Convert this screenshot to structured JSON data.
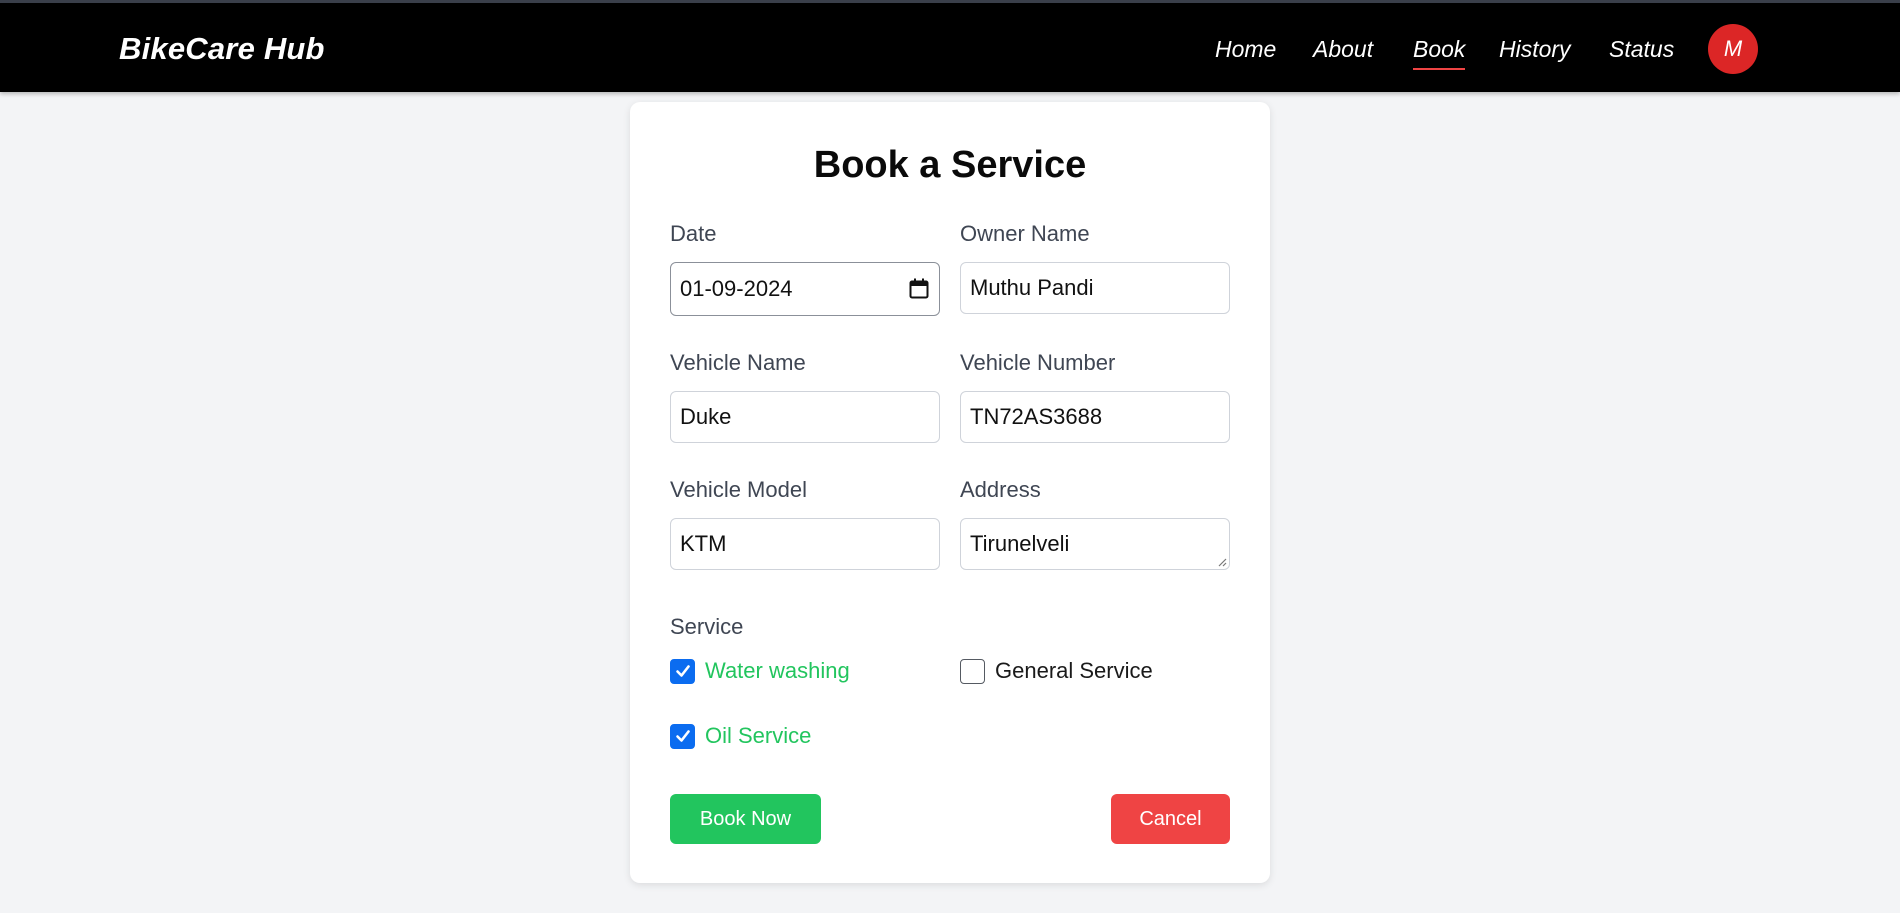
{
  "header": {
    "brand": "BikeCare Hub",
    "nav": [
      {
        "label": "Home",
        "active": false
      },
      {
        "label": "About",
        "active": false
      },
      {
        "label": "Book",
        "active": true
      },
      {
        "label": "History",
        "active": false
      },
      {
        "label": "Status",
        "active": false
      }
    ],
    "avatar_initial": "M",
    "colors": {
      "background": "#000000",
      "active_underline": "#ef4444",
      "avatar": "#dc2626"
    }
  },
  "form": {
    "title": "Book a Service",
    "fields": {
      "date": {
        "label": "Date",
        "value": "01-09-2024",
        "icon": "calendar-icon"
      },
      "owner_name": {
        "label": "Owner Name",
        "value": "Muthu Pandi"
      },
      "vehicle_name": {
        "label": "Vehicle Name",
        "value": "Duke"
      },
      "vehicle_number": {
        "label": "Vehicle Number",
        "value": "TN72AS3688"
      },
      "vehicle_model": {
        "label": "Vehicle Model",
        "value": "KTM"
      },
      "address": {
        "label": "Address",
        "value": "Tirunelveli"
      }
    },
    "service": {
      "label": "Service",
      "options": [
        {
          "label": "Water washing",
          "checked": true
        },
        {
          "label": "General Service",
          "checked": false
        },
        {
          "label": "Oil Service",
          "checked": true
        }
      ]
    },
    "actions": {
      "submit_label": "Book Now",
      "cancel_label": "Cancel"
    },
    "colors": {
      "checked_text": "#22c55e",
      "checkbox": "#0b6cf0",
      "submit": "#22c55e",
      "cancel": "#ef4444"
    }
  }
}
